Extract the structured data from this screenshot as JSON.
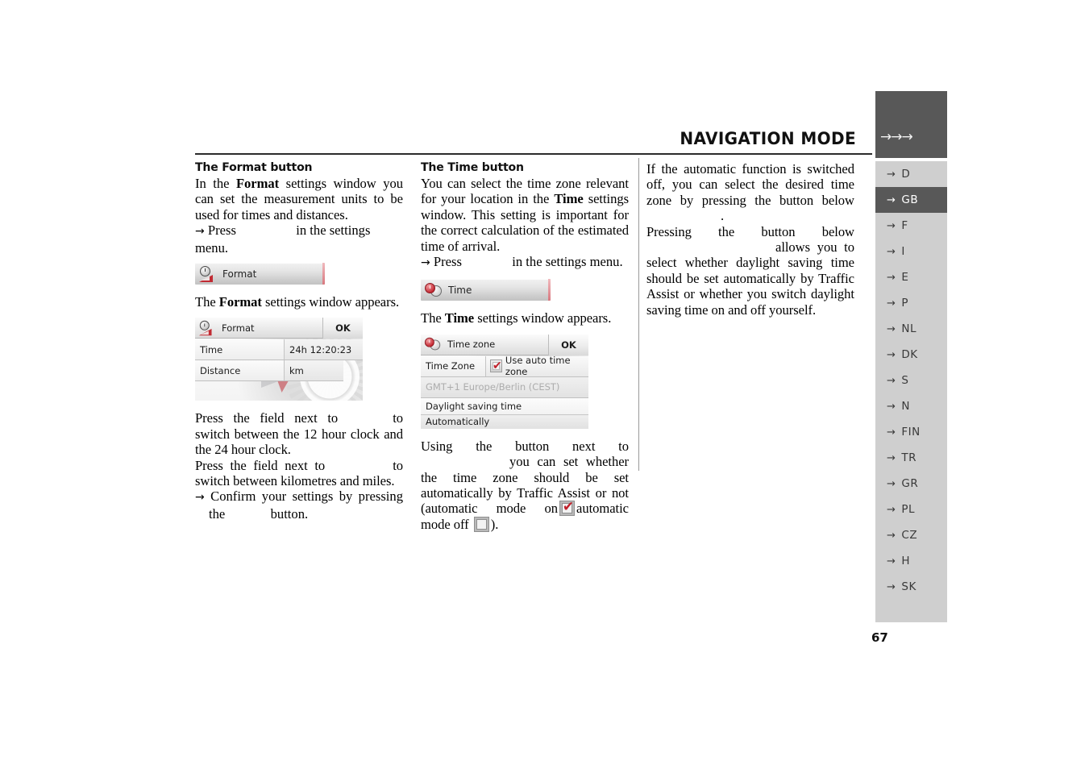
{
  "header": {
    "title": "NAVIGATION MODE",
    "arrows": "→→→"
  },
  "page_number": "67",
  "language_rail": {
    "items": [
      {
        "code": "D",
        "active": false
      },
      {
        "code": "GB",
        "active": true
      },
      {
        "code": "F",
        "active": false
      },
      {
        "code": "I",
        "active": false
      },
      {
        "code": "E",
        "active": false
      },
      {
        "code": "P",
        "active": false
      },
      {
        "code": "NL",
        "active": false
      },
      {
        "code": "DK",
        "active": false
      },
      {
        "code": "S",
        "active": false
      },
      {
        "code": "N",
        "active": false
      },
      {
        "code": "FIN",
        "active": false
      },
      {
        "code": "TR",
        "active": false
      },
      {
        "code": "GR",
        "active": false
      },
      {
        "code": "PL",
        "active": false
      },
      {
        "code": "CZ",
        "active": false
      },
      {
        "code": "H",
        "active": false
      },
      {
        "code": "SK",
        "active": false
      }
    ],
    "arrow_glyph": "→"
  },
  "column1": {
    "heading": "The Format button",
    "para1_a": "In the ",
    "para1_bold": "Format",
    "para1_b": " settings window you can set the measurement units to be used for times and distances.",
    "step1_arrow": "→",
    "step1_a": "Press",
    "step1_b": "in the settings menu.",
    "format_chip": {
      "label": "Format",
      "icon": "format-clock-ruler-icon"
    },
    "after_chip_a": "The ",
    "after_chip_bold": "Format",
    "after_chip_b": " settings window appears.",
    "device": {
      "title": "Format",
      "ok": "OK",
      "rows": [
        {
          "label": "Time",
          "value": "24h 12:20:23"
        },
        {
          "label": "Distance",
          "value": "km"
        }
      ]
    },
    "para2_a": "Press the field next to",
    "para2_b": "to switch between the 12 hour clock and the 24 hour clock.",
    "para3_a": "Press the field next to",
    "para3_b": "to switch between kilometres and miles.",
    "step2_arrow": "→",
    "step2_a": "Confirm your settings by pressing the",
    "step2_b": "button."
  },
  "column2": {
    "heading": "The Time button",
    "para1_a": "You can select the time zone relevant for your location in the ",
    "para1_bold": "Time",
    "para1_b": " settings window. This setting is important for the correct calculation of the estimated time of arrival.",
    "step1_arrow": "→",
    "step1_a": "Press",
    "step1_b": "in the settings menu.",
    "time_chip": {
      "label": "Time",
      "icon": "time-two-clocks-icon"
    },
    "after_chip_a": "The ",
    "after_chip_bold": "Time",
    "after_chip_b": " settings window appears.",
    "device": {
      "title": "Time zone",
      "ok": "OK",
      "row_label": "Time Zone",
      "checkbox_label": "Use auto time zone",
      "checkbox_checked": true,
      "disabled_value": "GMT+1 Europe/Berlin (CEST)",
      "dst_label": "Daylight saving time",
      "dst_value": "Automatically"
    },
    "para2_a": "Using the button next to",
    "para2_b": "you can set whether the time zone should be set automatically by Traffic Assist or not (automatic mode on",
    "para2_c": "automatic mode off",
    "para2_d": ").",
    "checkbox_on_name": "checkbox-checked-icon",
    "checkbox_off_name": "checkbox-unchecked-icon"
  },
  "column3": {
    "para1_a": "If the automatic function is switched off, you can select the desired time zone by pressing the button below",
    "para1_b": ".",
    "para2_a": "Pressing the button below",
    "para2_b": "allows you to select whether daylight saving time should be set automatically by Traffic Assist or whether you switch daylight saving time on and off yourself."
  },
  "colors": {
    "rail_bg": "#cfcfcf",
    "rail_active": "#585858",
    "accent_red": "#c0202a",
    "rule": "#2b2b2b"
  }
}
